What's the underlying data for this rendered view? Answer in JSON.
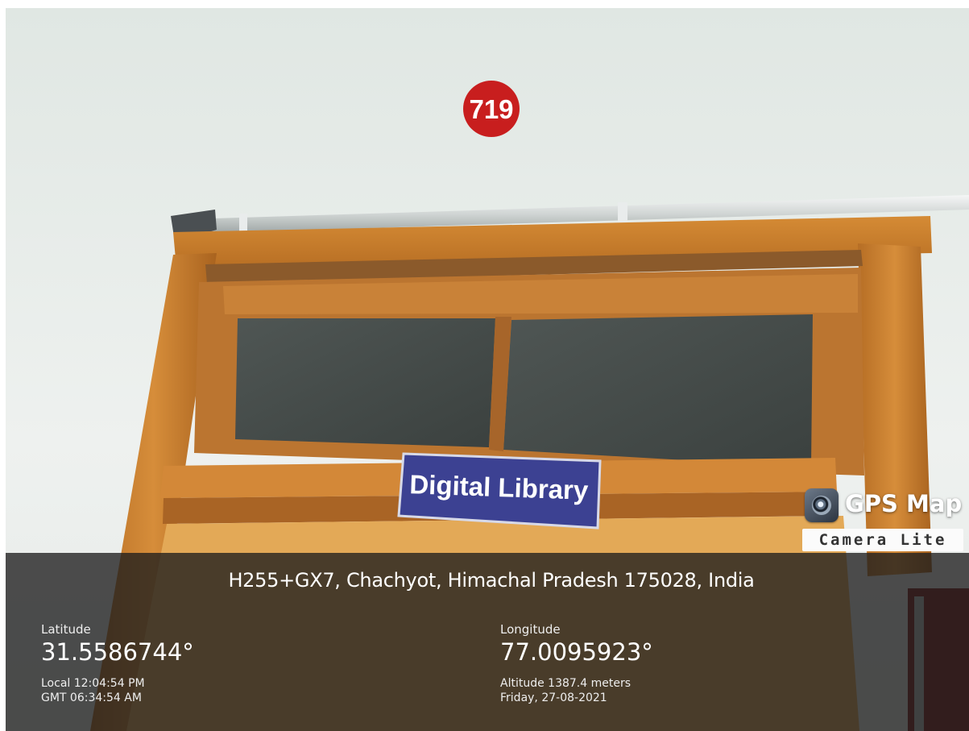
{
  "photo": {
    "room_number": "719",
    "sign_text": "Digital Library"
  },
  "watermark": {
    "app_name_line1": "GPS Map",
    "app_name_line2": "Camera Lite",
    "icon": "camera-lens-icon"
  },
  "location": {
    "address": "H255+GX7, Chachyot, Himachal Pradesh 175028, India",
    "latitude_label": "Latitude",
    "latitude_value": "31.5586744°",
    "longitude_label": "Longitude",
    "longitude_value": "77.0095923°",
    "local_time": "Local 12:04:54 PM",
    "gmt_time": "GMT 06:34:54 AM",
    "altitude": "Altitude 1387.4 meters",
    "date": "Friday, 27-08-2021"
  },
  "colors": {
    "wall": "#e8ecea",
    "door_frame": "#c27a2c",
    "badge_red": "#c81e1e",
    "sign_blue": "#3c4192",
    "overlay": "#1e1e1e"
  }
}
